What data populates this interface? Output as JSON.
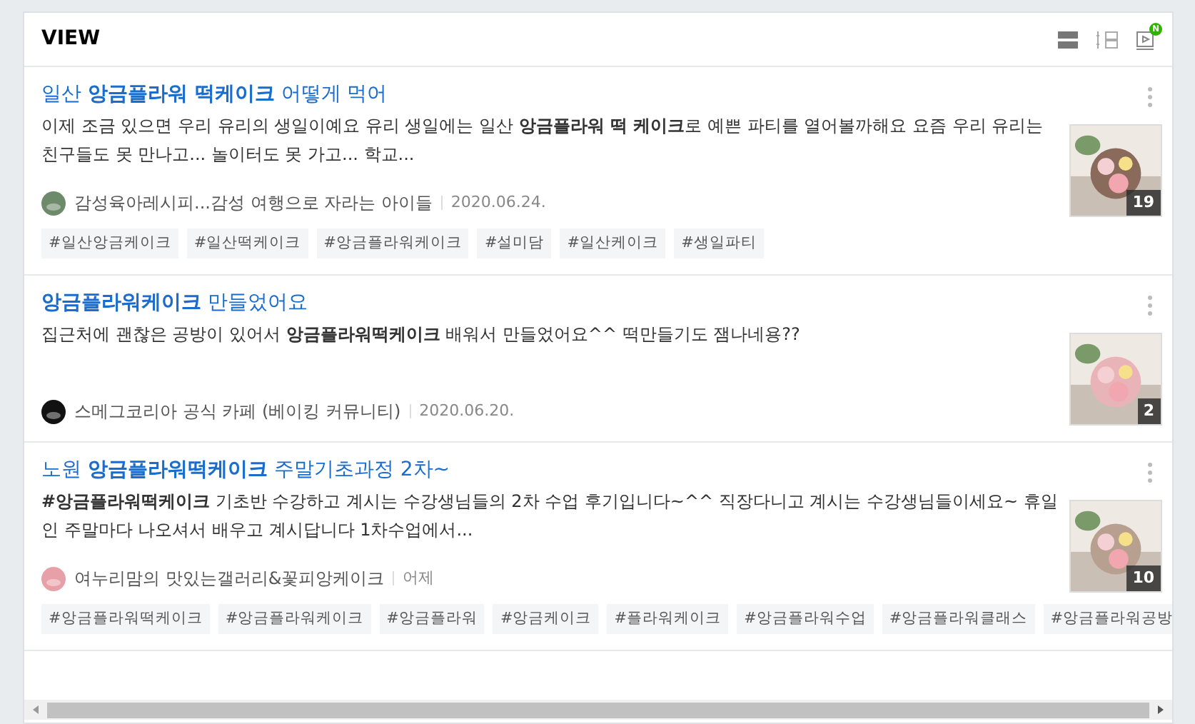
{
  "header": {
    "title": "VIEW",
    "new_badge": "N"
  },
  "posts": [
    {
      "title": "일산 **앙금플라워 떡케이크** 어떻게 먹어",
      "summary": "이제 조금 있으면 우리 유리의 생일이예요 유리 생일에는 일산 **앙금플라워 떡 케이크**로 예쁜 파티를 열어볼까해요 요즘 우리 유리는 친구들도 못 만나고... 놀이터도 못 가고... 학교...",
      "author": "감성육아레시피...감성 여행으로 자라는 아이들",
      "date": "2020.06.24.",
      "photo_count": "19",
      "tags": [
        "#일산앙금케이크",
        "#일산떡케이크",
        "#앙금플라워케이크",
        "#설미담",
        "#일산케이크",
        "#생일파티"
      ]
    },
    {
      "title": "**앙금플라워케이크** 만들었어요",
      "summary": "집근처에 괜찮은 공방이 있어서 **앙금플라워떡케이크** 배워서 만들었어요^^ 떡만들기도 잼나네용??",
      "author": "스메그코리아 공식 카페 (베이킹 커뮤니티)",
      "date": "2020.06.20.",
      "photo_count": "2"
    },
    {
      "title": "노원 **앙금플라워떡케이크** 주말기초과정 2차~",
      "summary": "**#앙금플라워떡케이크** 기초반 수강하고 계시는 수강생님들의 2차 수업 후기입니다~^^ 직장다니고 계시는 수강생님들이세요~ 휴일인 주말마다 나오셔서 배우고 계시답니다 1차수업에서...",
      "author": "여누리맘의 맛있는갤러리&꽃피앙케이크",
      "date": "어제",
      "photo_count": "10",
      "tags": [
        "#앙금플라워떡케이크",
        "#앙금플라워케이크",
        "#앙금플라워",
        "#앙금케이크",
        "#플라워케이크",
        "#앙금플라워수업",
        "#앙금플라워클래스",
        "#앙금플라워공방"
      ]
    }
  ]
}
